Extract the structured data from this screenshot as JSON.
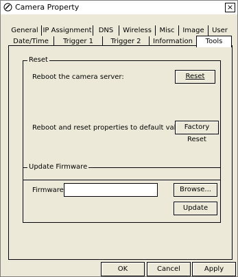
{
  "window": {
    "title": "Camera Property",
    "close_glyph": "×",
    "app_icon": "camera-icon"
  },
  "tabs": {
    "row1": [
      {
        "label": "General"
      },
      {
        "label": "IP Assignment"
      },
      {
        "label": "DNS"
      },
      {
        "label": "Wireless"
      },
      {
        "label": "Misc"
      },
      {
        "label": "Image"
      },
      {
        "label": "User"
      }
    ],
    "row2": [
      {
        "label": "Date/Time"
      },
      {
        "label": "Trigger 1"
      },
      {
        "label": "Trigger 2"
      },
      {
        "label": "Information"
      },
      {
        "label": "Tools",
        "selected": true
      }
    ]
  },
  "reset_group": {
    "legend": "Reset",
    "reboot_label": "Reboot the camera server:",
    "reset_button": "Reset",
    "factory_label": "Reboot and reset properties to default value:",
    "factory_button": "Factory Reset"
  },
  "firmware_group": {
    "legend": "Update Firmware",
    "firmware_label": "Firmware",
    "firmware_value": "",
    "browse_button": "Browse...",
    "update_button": "Update"
  },
  "footer": {
    "ok": "OK",
    "cancel": "Cancel",
    "apply": "Apply"
  }
}
